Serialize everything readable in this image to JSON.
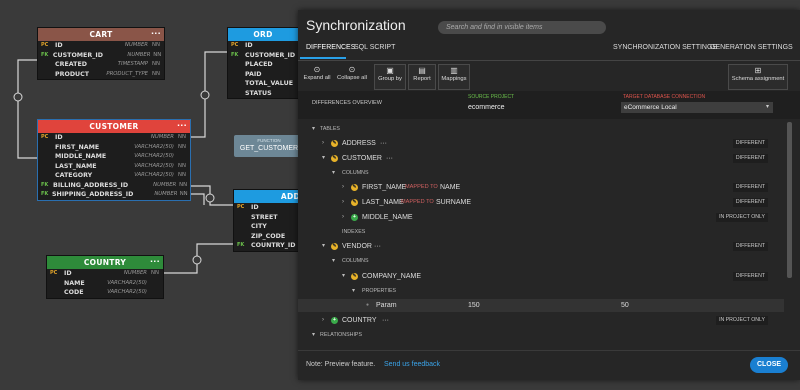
{
  "diagram": {
    "tables": {
      "cart": {
        "name": "CART",
        "color": "#8a5548",
        "columns": [
          {
            "key": "PC",
            "name": "ID",
            "type": "NUMBER",
            "nn": "NN"
          },
          {
            "key": "FK",
            "name": "CUSTOMER_ID",
            "type": "NUMBER",
            "nn": "NN"
          },
          {
            "key": "",
            "name": "CREATED",
            "type": "TIMESTAMP",
            "nn": "NN"
          },
          {
            "key": "",
            "name": "PRODUCT",
            "type": "PRODUCT_TYPE",
            "nn": "NN"
          }
        ]
      },
      "order": {
        "name": "ORD",
        "color": "#1e9be0",
        "columns": [
          {
            "key": "PC",
            "name": "ID"
          },
          {
            "key": "FK",
            "name": "CUSTOMER_ID"
          },
          {
            "key": "",
            "name": "PLACED"
          },
          {
            "key": "",
            "name": "PAID"
          },
          {
            "key": "",
            "name": "TOTAL_VALUE"
          },
          {
            "key": "",
            "name": "STATUS"
          }
        ]
      },
      "customer": {
        "name": "CUSTOMER",
        "color": "#e0443c",
        "columns": [
          {
            "key": "PC",
            "name": "ID",
            "type": "NUMBER",
            "nn": "NN"
          },
          {
            "key": "",
            "name": "FIRST_NAME",
            "type": "VARCHAR2(50)",
            "nn": "NN"
          },
          {
            "key": "",
            "name": "MIDDLE_NAME",
            "type": "VARCHAR2(50)",
            "nn": ""
          },
          {
            "key": "",
            "name": "LAST_NAME",
            "type": "VARCHAR2(50)",
            "nn": "NN"
          },
          {
            "key": "",
            "name": "CATEGORY",
            "type": "VARCHAR2(50)",
            "nn": "NN"
          },
          {
            "key": "FK",
            "name": "BILLING_ADDRESS_ID",
            "type": "NUMBER",
            "nn": "NN"
          },
          {
            "key": "FK",
            "name": "SHIPPING_ADDRESS_ID",
            "type": "NUMBER",
            "nn": "NN"
          }
        ]
      },
      "address": {
        "name": "ADD",
        "color": "#1e9be0",
        "columns": [
          {
            "key": "PC",
            "name": "ID"
          },
          {
            "key": "",
            "name": "STREET"
          },
          {
            "key": "",
            "name": "CITY"
          },
          {
            "key": "",
            "name": "ZIP_CODE"
          },
          {
            "key": "FK",
            "name": "COUNTRY_ID"
          }
        ]
      },
      "country": {
        "name": "COUNTRY",
        "color": "#2e8b3a",
        "columns": [
          {
            "key": "PC",
            "name": "ID",
            "type": "NUMBER",
            "nn": "NN"
          },
          {
            "key": "",
            "name": "NAME",
            "type": "VARCHAR2(50)",
            "nn": ""
          },
          {
            "key": "",
            "name": "CODE",
            "type": "VARCHAR2(50)",
            "nn": ""
          }
        ]
      }
    },
    "function_box": {
      "label": "FUNCTION",
      "name": "GET_CUSTOMER"
    },
    "menu_glyph": "···"
  },
  "dialog": {
    "title": "Synchronization",
    "search_placeholder": "Search and find in visible items",
    "tabs": {
      "differences": "DIFFERENCES",
      "sql_script": "SQL SCRIPT",
      "sync_settings": "SYNCHRONIZATION SETTINGS",
      "gen_settings": "GENERATION SETTINGS"
    },
    "toolbar": {
      "expand_all": "Expand all",
      "collapse_all": "Collapse all",
      "group_by": "Group by",
      "report": "Report",
      "mappings": "Mappings",
      "schema_assignment": "Schema assignment"
    },
    "overview": {
      "label": "DIFFERENCES OVERVIEW",
      "source_label": "SOURCE PROJECT",
      "source_value": "ecommerce",
      "target_label": "TARGET DATABASE CONNECTION",
      "target_value": "eCommerce Local"
    },
    "tree": {
      "tables": "TABLES",
      "address": "ADDRESS",
      "customer": "CUSTOMER",
      "columns": "COLUMNS",
      "first_name": "FIRST_NAME",
      "mapped_to": "MAPPED TO",
      "name_target": "NAME",
      "last_name": "LAST_NAME",
      "surname": "SURNAME",
      "middle_name": "MIDDLE_NAME",
      "indexes": "INDEXES",
      "vendor": "VENDOR",
      "columns2": "COLUMNS",
      "company_name": "COMPANY_NAME",
      "properties": "PROPERTIES",
      "param": "Param",
      "param_source": "150",
      "param_target": "50",
      "country": "COUNTRY",
      "relationships": "RELATIONSHIPS",
      "different": "DIFFERENT",
      "in_project_only": "IN PROJECT ONLY"
    },
    "footer": {
      "note": "Note: Preview feature.",
      "feedback": "Send us feedback",
      "close": "CLOSE"
    }
  }
}
